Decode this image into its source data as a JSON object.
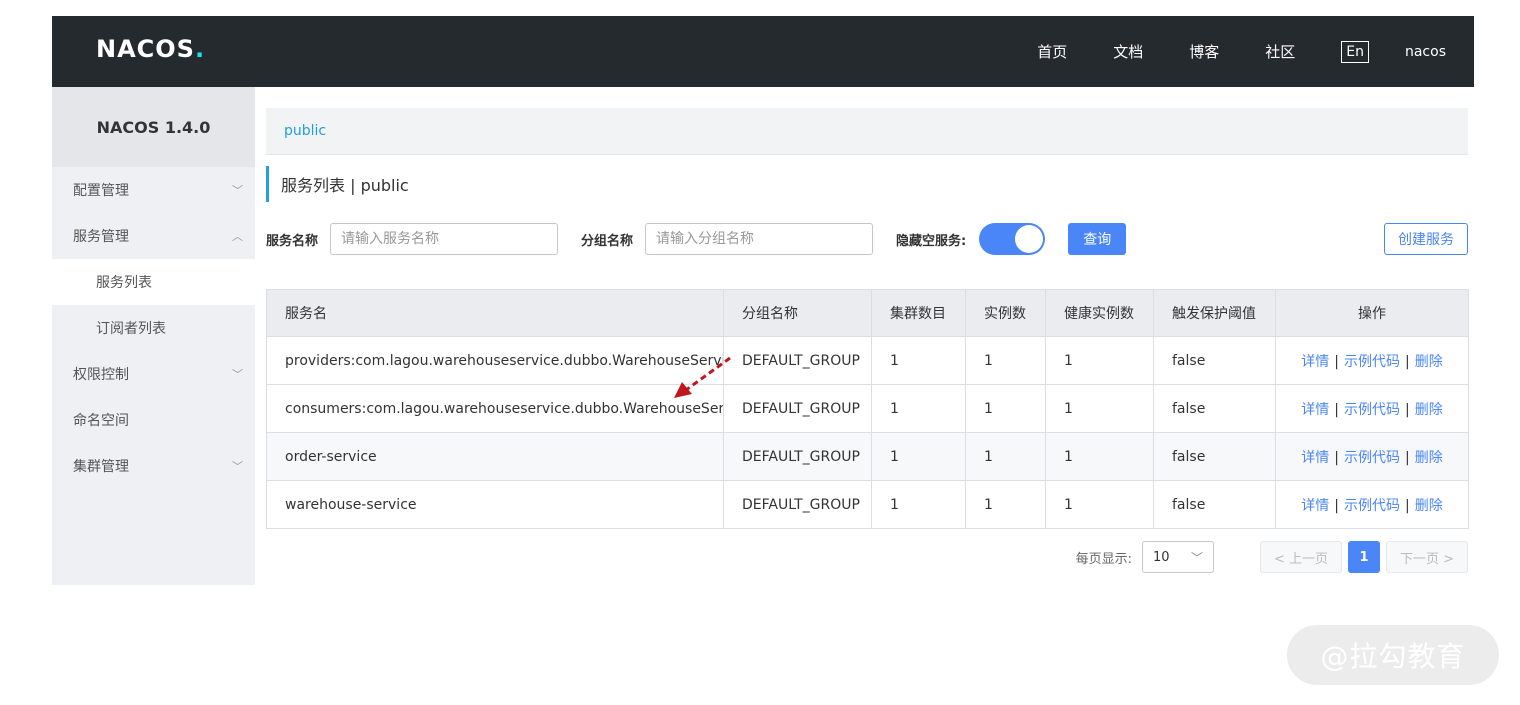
{
  "header": {
    "logo": "NACOS",
    "logo_dot": ".",
    "nav": [
      "首页",
      "文档",
      "博客",
      "社区"
    ],
    "lang": "En",
    "user": "nacos"
  },
  "sidebar": {
    "title": "NACOS 1.4.0",
    "items": [
      {
        "label": "配置管理",
        "chevron": "chevron-down"
      },
      {
        "label": "服务管理",
        "chevron": "chevron-up"
      },
      {
        "label": "服务列表"
      },
      {
        "label": "订阅者列表"
      },
      {
        "label": "权限控制",
        "chevron": "chevron-down"
      },
      {
        "label": "命名空间"
      },
      {
        "label": "集群管理",
        "chevron": "chevron-down"
      }
    ]
  },
  "namespace": "public",
  "page_title": "服务列表  |  public",
  "filters": {
    "service_label": "服务名称",
    "service_placeholder": "请输入服务名称",
    "group_label": "分组名称",
    "group_placeholder": "请输入分组名称",
    "hide_empty_label": "隐藏空服务:",
    "hide_empty_on": true,
    "search_button": "查询",
    "create_button": "创建服务"
  },
  "table": {
    "headers": [
      "服务名",
      "分组名称",
      "集群数目",
      "实例数",
      "健康实例数",
      "触发保护阈值",
      "操作"
    ],
    "rows": [
      [
        "providers:com.lagou.warehouseservice.dubbo.WarehouseService::",
        "DEFAULT_GROUP",
        "1",
        "1",
        "1",
        "false"
      ],
      [
        "consumers:com.lagou.warehouseservice.dubbo.WarehouseService::",
        "DEFAULT_GROUP",
        "1",
        "1",
        "1",
        "false"
      ],
      [
        "order-service",
        "DEFAULT_GROUP",
        "1",
        "1",
        "1",
        "false"
      ],
      [
        "warehouse-service",
        "DEFAULT_GROUP",
        "1",
        "1",
        "1",
        "false"
      ]
    ],
    "actions": {
      "detail": "详情",
      "sample": "示例代码",
      "delete": "删除",
      "sep": "|"
    }
  },
  "pagination": {
    "page_size_label": "每页显示:",
    "page_size": "10",
    "prev": "< 上一页",
    "current": "1",
    "next": "下一页 >"
  },
  "watermark": "@拉勾教育",
  "colors": {
    "accent": "#4a86f7",
    "topbar": "#252a2f",
    "arrow": "#c0171d"
  }
}
